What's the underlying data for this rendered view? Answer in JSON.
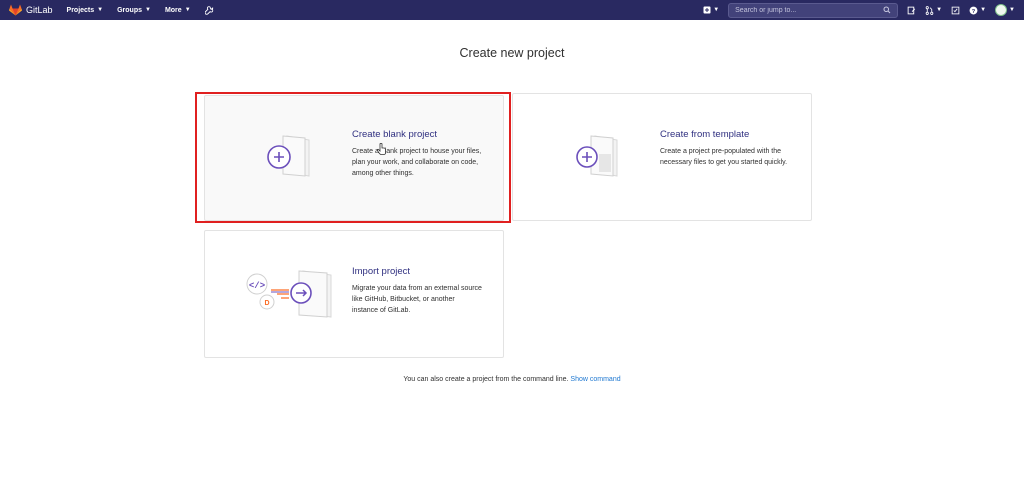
{
  "navbar": {
    "brand": "GitLab",
    "items": [
      {
        "label": "Projects"
      },
      {
        "label": "Groups"
      },
      {
        "label": "More"
      }
    ],
    "search_placeholder": "Search or jump to...",
    "bg_color": "#292961"
  },
  "page": {
    "title": "Create new project"
  },
  "cards": {
    "blank": {
      "title": "Create blank project",
      "description": "Create a blank project to house your files, plan your work, and collaborate on code, among other things."
    },
    "template": {
      "title": "Create from template",
      "description": "Create a project pre-populated with the necessary files to get you started quickly."
    },
    "import": {
      "title": "Import project",
      "description": "Migrate your data from an external source like GitHub, Bitbucket, or another instance of GitLab."
    }
  },
  "footer": {
    "cli_text": "You can also create a project from the command line.",
    "cli_link": "Show command"
  },
  "colors": {
    "accent": "#6b4fbb",
    "link": "#1f78d1",
    "highlight": "#e02020"
  }
}
